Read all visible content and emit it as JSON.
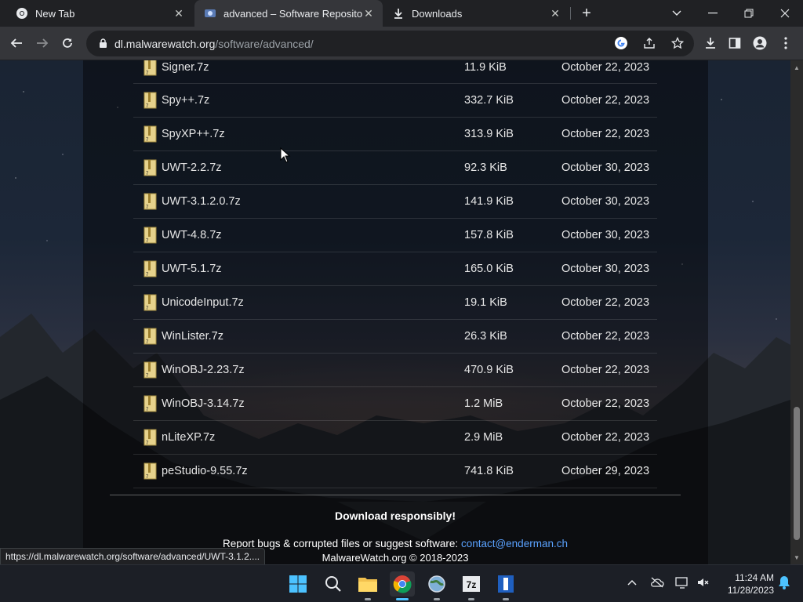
{
  "tabs": [
    {
      "title": "New Tab",
      "icon": "chrome-icon"
    },
    {
      "title": "advanced – Software Repository",
      "icon": "site-favicon"
    },
    {
      "title": "Downloads",
      "icon": "download-icon"
    }
  ],
  "toolbar": {
    "url_host": "dl.malwarewatch.org",
    "url_path": "/software/advanced/"
  },
  "files": [
    {
      "name": "Signer.7z",
      "size": "11.9 KiB",
      "date": "October 22, 2023"
    },
    {
      "name": "Spy++.7z",
      "size": "332.7 KiB",
      "date": "October 22, 2023"
    },
    {
      "name": "SpyXP++.7z",
      "size": "313.9 KiB",
      "date": "October 22, 2023"
    },
    {
      "name": "UWT-2.2.7z",
      "size": "92.3 KiB",
      "date": "October 30, 2023"
    },
    {
      "name": "UWT-3.1.2.0.7z",
      "size": "141.9 KiB",
      "date": "October 30, 2023"
    },
    {
      "name": "UWT-4.8.7z",
      "size": "157.8 KiB",
      "date": "October 30, 2023"
    },
    {
      "name": "UWT-5.1.7z",
      "size": "165.0 KiB",
      "date": "October 30, 2023"
    },
    {
      "name": "UnicodeInput.7z",
      "size": "19.1 KiB",
      "date": "October 22, 2023"
    },
    {
      "name": "WinLister.7z",
      "size": "26.3 KiB",
      "date": "October 22, 2023"
    },
    {
      "name": "WinOBJ-2.23.7z",
      "size": "470.9 KiB",
      "date": "October 22, 2023"
    },
    {
      "name": "WinOBJ-3.14.7z",
      "size": "1.2 MiB",
      "date": "October 22, 2023"
    },
    {
      "name": "nLiteXP.7z",
      "size": "2.9 MiB",
      "date": "October 22, 2023"
    },
    {
      "name": "peStudio-9.55.7z",
      "size": "741.8 KiB",
      "date": "October 29, 2023"
    }
  ],
  "footer": {
    "tagline": "Download responsibly!",
    "report_text": "Report bugs & corrupted files or suggest software:",
    "contact_email": "contact@enderman.ch",
    "copyright": "MalwareWatch.org © 2018-2023"
  },
  "status_url": "https://dl.malwarewatch.org/software/advanced/UWT-3.1.2....",
  "taskbar": {
    "time": "11:24 AM",
    "date": "11/28/2023",
    "apps": [
      "start-icon",
      "search-icon",
      "file-explorer-icon",
      "chrome-icon",
      "globe-app-icon",
      "7zip-icon",
      "app-icon"
    ]
  },
  "colors": {
    "link": "#5aa2ff",
    "taskbar_active": "#4cc2ff",
    "folder": "#d9c27a"
  }
}
